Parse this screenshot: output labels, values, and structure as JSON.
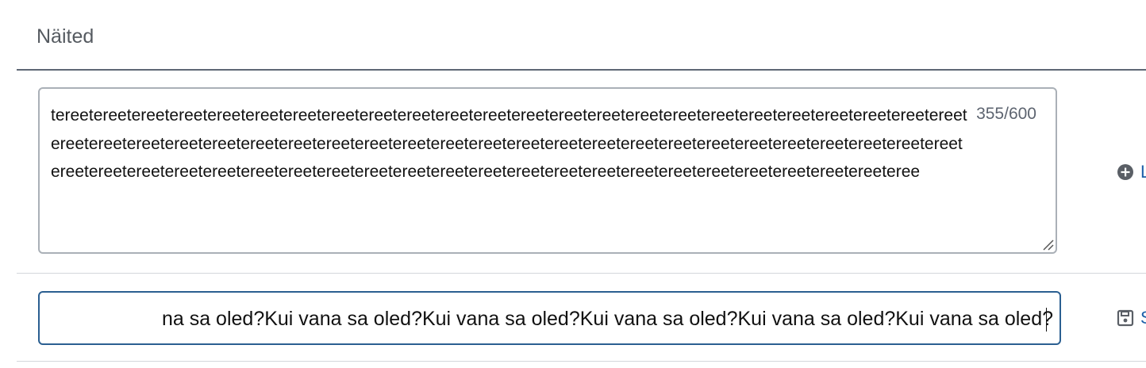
{
  "section": {
    "title": "Näited"
  },
  "examples": [
    {
      "text": "tereetereetereetereetereetereetereetereetereetereetereetereetereetereetereetereetereetereetereetereetereetereetereetereetereetereetereetereetereetereetereetereetereetereetereetereetereetereetereetereetereetereetereetereetereetereetereetereetereetereetereetereetereetereetereetereetereetereetereetereetereetereetereetereetereetereetereetereetereetereeteree",
      "char_count": "355/600",
      "action_icon": "plus-circle-icon",
      "action_label": "L"
    }
  ],
  "editing": {
    "value": "na sa oled?Kui vana sa oled?Kui vana sa oled?Kui vana sa oled?Kui vana sa oled?Kui vana sa oled?",
    "action_icon": "save-icon",
    "action_label": "S"
  }
}
